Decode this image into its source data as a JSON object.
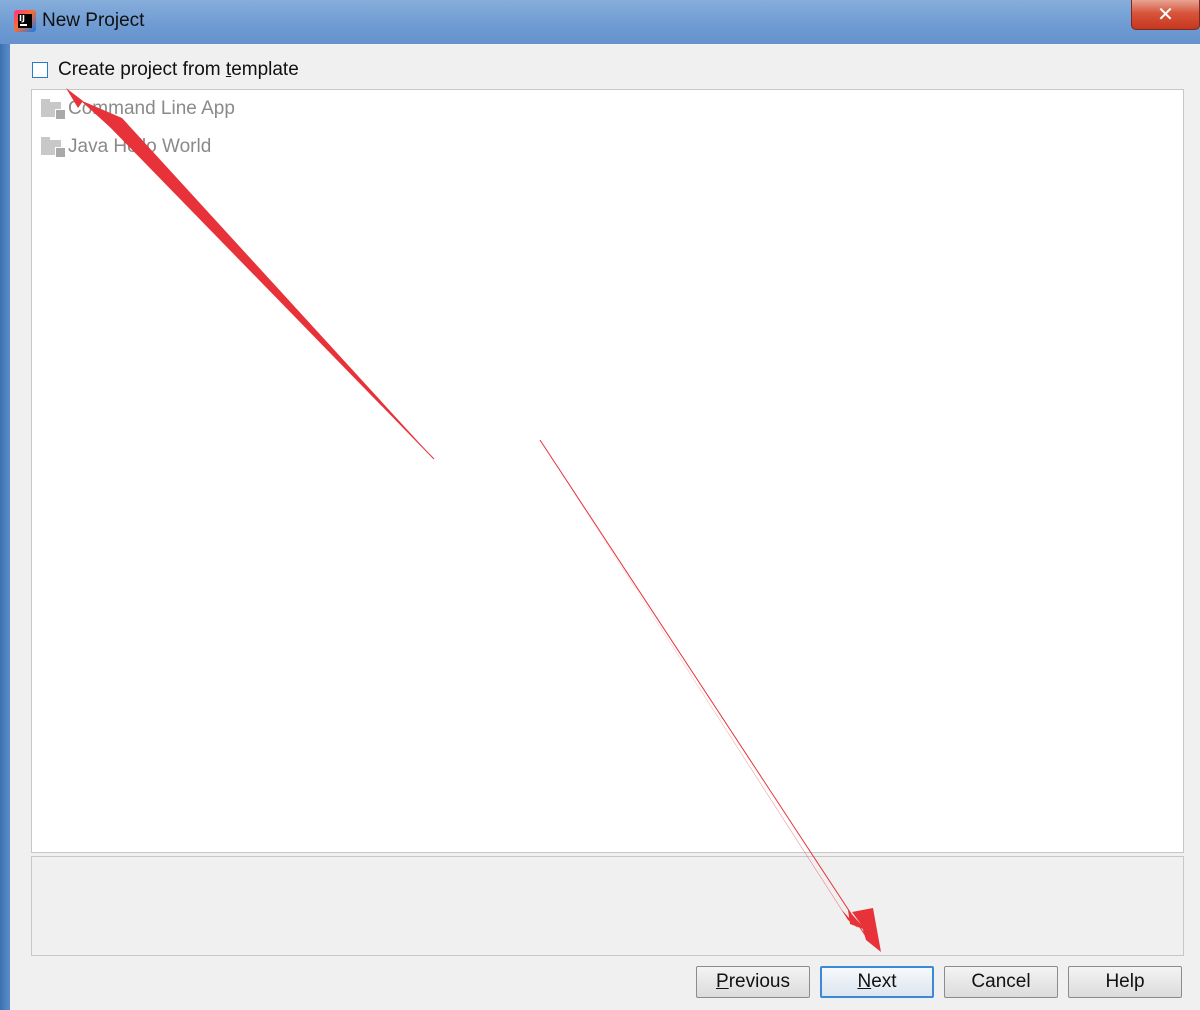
{
  "window": {
    "title": "New Project",
    "close_glyph": "✕"
  },
  "template_checkbox": {
    "label_before": "Create project from ",
    "label_mnemonic": "t",
    "label_after": "emplate",
    "checked": false
  },
  "templates": [
    {
      "label": "Command Line App",
      "icon": "folder-icon"
    },
    {
      "label": "Java Hello World",
      "icon": "folder-icon"
    }
  ],
  "buttons": {
    "previous": {
      "mnemonic": "P",
      "rest": "revious"
    },
    "next": {
      "mnemonic": "N",
      "rest": "ext"
    },
    "cancel": "Cancel",
    "help": "Help"
  },
  "colors": {
    "annotation_arrow": "#e8323a",
    "titlebar": "#6f9cd3",
    "focus_border": "#3c8ad6"
  }
}
